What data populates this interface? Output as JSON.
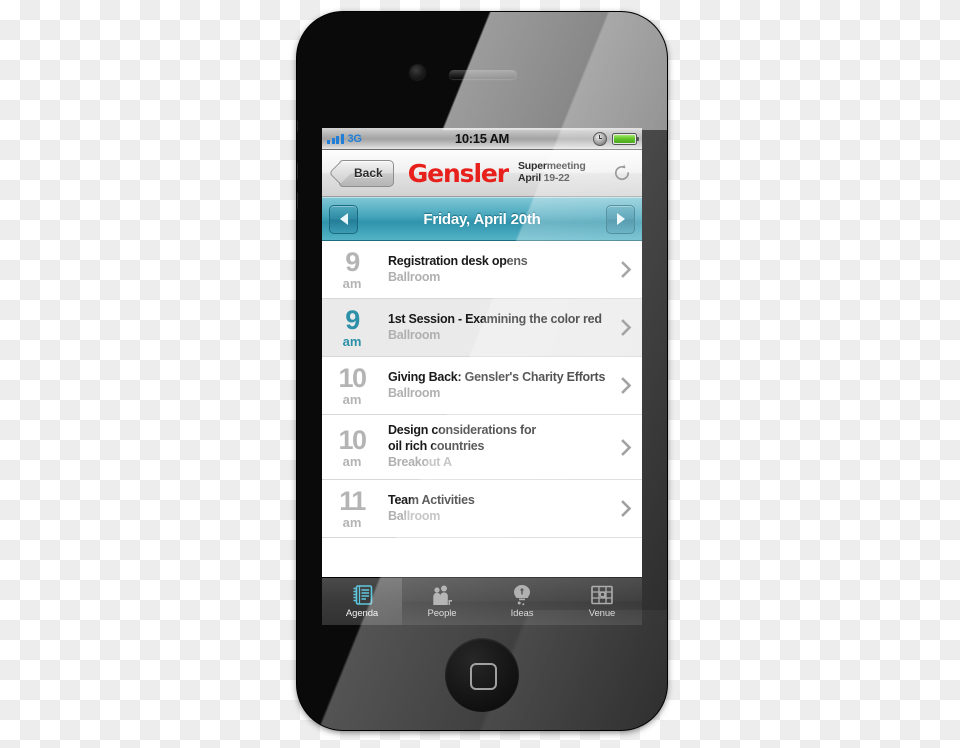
{
  "device": {
    "name": "iphone-4",
    "home_button": "home-button",
    "speaker": "earpiece-speaker",
    "camera": "front-camera"
  },
  "status_bar": {
    "carrier": "3G",
    "signal_bars": 4,
    "time": "10:15 AM",
    "alarm_icon": "clock-icon",
    "battery_icon": "battery-icon",
    "battery_level": 100,
    "battery_color": "#62c52a",
    "carrier_color": "#1f7fd8"
  },
  "nav_bar": {
    "back_label": "Back",
    "logo": "Gensler",
    "logo_color": "#e8201c",
    "meeting_title": "Supermeeting",
    "meeting_dates": "April 19-22",
    "refresh_icon": "refresh-icon"
  },
  "date_bar": {
    "prev_icon": "chevron-left-icon",
    "next_icon": "chevron-right-icon",
    "current_date": "Friday, April 20th",
    "accent_color": "#2f94ac"
  },
  "agenda": {
    "rows": [
      {
        "hour": "9",
        "meridiem": "am",
        "title": "Registration desk opens",
        "location": "Ballroom",
        "selected": false,
        "title_lines": [
          "Registration desk opens"
        ]
      },
      {
        "hour": "9",
        "meridiem": "am",
        "title": "1st Session - Examining the color red",
        "location": "Ballroom",
        "selected": true,
        "title_lines": [
          "1st Session - Examining the color red"
        ]
      },
      {
        "hour": "10",
        "meridiem": "am",
        "title": "Giving Back: Gensler's Charity Efforts",
        "location": "Ballroom",
        "selected": false,
        "title_lines": [
          "Giving Back: Gensler's Charity Efforts"
        ]
      },
      {
        "hour": "10",
        "meridiem": "am",
        "title": "Design considerations for oil rich countries",
        "location": "Breakout A",
        "selected": false,
        "title_lines": [
          "Design considerations for",
          "oil rich countries"
        ]
      },
      {
        "hour": "11",
        "meridiem": "am",
        "title": "Team Activities",
        "location": "Ballroom",
        "selected": false,
        "title_lines": [
          "Team Activities"
        ]
      }
    ],
    "disclosure_icon": "chevron-right-icon"
  },
  "tab_bar": {
    "active_color": "#5ec8e0",
    "tabs": [
      {
        "label": "Agenda",
        "icon": "notebook-icon",
        "active": true
      },
      {
        "label": "People",
        "icon": "people-icon",
        "active": false
      },
      {
        "label": "Ideas",
        "icon": "lightbulb-icon",
        "active": false
      },
      {
        "label": "Venue",
        "icon": "map-icon",
        "active": false
      }
    ]
  }
}
